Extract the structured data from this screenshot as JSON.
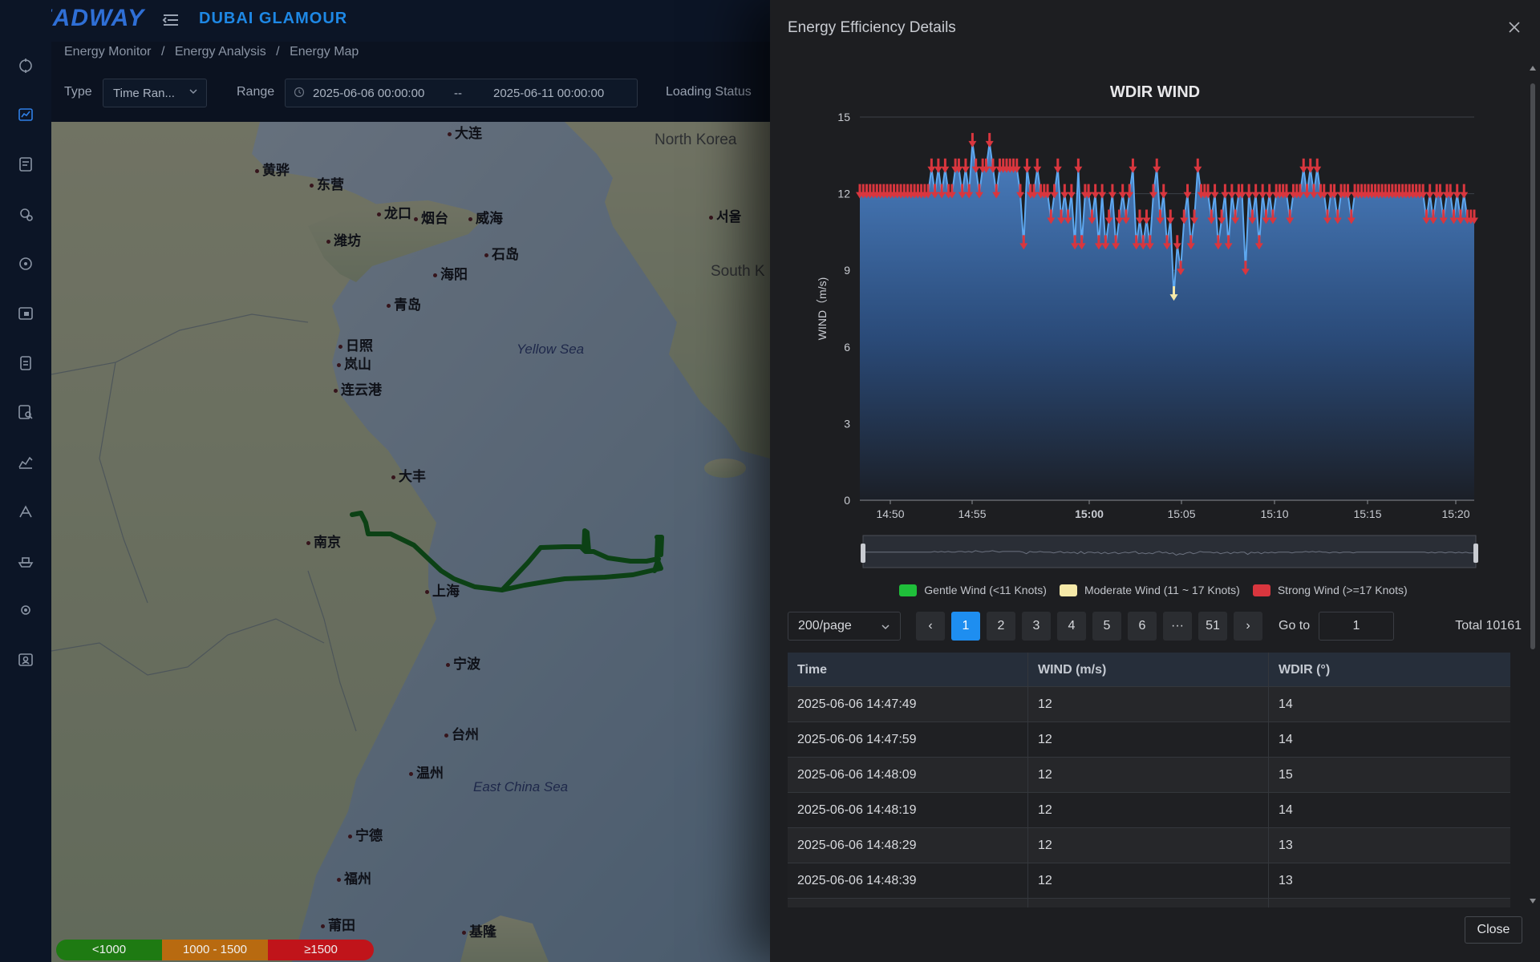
{
  "app": {
    "logo_main": "HEADWAY",
    "vessel_name": "DUBAI GLAMOUR",
    "icons": [
      "menu-toggle-icon"
    ]
  },
  "breadcrumb": [
    "Energy Monitor",
    "/",
    "Energy Analysis",
    "/",
    "Energy Map"
  ],
  "filters": {
    "type_label": "Type",
    "type_value": "Time Ran...",
    "range_label": "Range",
    "range_start": "2025-06-06 00:00:00",
    "range_sep": "--",
    "range_end": "2025-06-11 00:00:00",
    "loading_label": "Loading Status"
  },
  "sidebar": {
    "icons": [
      "compass-icon",
      "chart-icon",
      "report-icon",
      "settings-gear-icon",
      "target-icon",
      "calendar-icon",
      "clipboard-icon",
      "search-doc-icon",
      "trend-icon",
      "tools-icon",
      "ship-icon",
      "gear-icon",
      "user-card-icon"
    ]
  },
  "map": {
    "places": [
      {
        "name": "大连"
      },
      {
        "name": "黄骅"
      },
      {
        "name": "东营"
      },
      {
        "name": "龙口"
      },
      {
        "name": "烟台"
      },
      {
        "name": "威海"
      },
      {
        "name": "潍坊"
      },
      {
        "name": "石岛"
      },
      {
        "name": "海阳"
      },
      {
        "name": "青岛"
      },
      {
        "name": "日照"
      },
      {
        "name": "岚山"
      },
      {
        "name": "连云港"
      },
      {
        "name": "大丰"
      },
      {
        "name": "南京"
      },
      {
        "name": "上海"
      },
      {
        "name": "宁波"
      },
      {
        "name": "台州"
      },
      {
        "name": "温州"
      },
      {
        "name": "宁德"
      },
      {
        "name": "福州"
      },
      {
        "name": "莆田"
      },
      {
        "name": "基隆"
      },
      {
        "name": "서울"
      }
    ],
    "seas": [
      "Yellow Sea",
      "East China Sea"
    ],
    "countries": [
      "North Korea",
      "South K"
    ],
    "legend": [
      {
        "label": "<1000",
        "color": "#1e7a12"
      },
      {
        "label": "1000 - 1500",
        "color": "#b86a10"
      },
      {
        "label": "≥1500",
        "color": "#c0141a"
      }
    ],
    "route_color": "#0d6b0d"
  },
  "drawer": {
    "title": "Energy Efficiency Details",
    "close_button": "Close"
  },
  "chart_data": {
    "type": "line",
    "title": "WDIR WIND",
    "ylabel": "WIND（m/s)",
    "xlabel": "",
    "ylim": [
      0,
      15
    ],
    "yticks": [
      "0",
      "3",
      "6",
      "9",
      "12",
      "15"
    ],
    "xticks": [
      "14:50",
      "14:55",
      "15:00",
      "15:05",
      "15:10",
      "15:15",
      "15:20"
    ],
    "x_range": [
      "14:47:49",
      "15:20:30"
    ],
    "grid": true,
    "legend_position": "bottom",
    "legend": [
      {
        "name": "Gentle Wind (<11 Knots)",
        "color": "#1fbf3a"
      },
      {
        "name": "Moderate Wind (11 ~ 17 Knots)",
        "color": "#f5e9a8"
      },
      {
        "name": "Strong Wind (>=17 Knots)",
        "color": "#d9363e"
      }
    ],
    "series": [
      {
        "name": "WIND",
        "line_color": "#5ea8f0",
        "values": [
          12,
          12,
          12,
          12,
          12,
          12,
          12,
          12,
          12,
          12,
          12,
          12,
          12,
          12,
          12,
          12,
          12,
          12,
          12,
          12,
          12,
          13,
          12,
          13,
          12,
          13,
          12,
          12,
          13,
          13,
          12,
          13,
          12,
          14,
          13,
          12,
          13,
          13,
          14,
          13,
          12,
          13,
          13,
          13,
          13,
          13,
          13,
          12,
          10,
          13,
          12,
          12,
          13,
          12,
          12,
          12,
          11,
          12,
          13,
          11,
          12,
          11,
          12,
          10,
          13,
          10,
          12,
          12,
          11,
          12,
          10,
          12,
          10,
          11,
          12,
          10,
          11,
          12,
          11,
          12,
          13,
          10,
          11,
          10,
          11,
          10,
          12,
          13,
          11,
          12,
          10,
          11,
          8,
          10,
          9,
          11,
          12,
          10,
          11,
          13,
          12,
          12,
          12,
          11,
          12,
          10,
          11,
          12,
          10,
          12,
          11,
          12,
          12,
          9,
          12,
          11,
          12,
          10,
          12,
          11,
          12,
          11,
          12,
          12,
          12,
          12,
          11,
          12,
          12,
          12,
          13,
          12,
          13,
          12,
          13,
          12,
          12,
          11,
          12,
          12,
          11,
          12,
          12,
          12,
          11,
          12,
          12,
          12,
          12,
          12,
          12,
          12,
          12,
          12,
          12,
          12,
          12,
          12,
          12,
          12,
          12,
          12,
          12,
          12,
          12,
          12,
          11,
          12,
          11,
          12,
          12,
          11,
          12,
          12,
          11,
          12,
          11,
          12,
          11,
          11,
          11
        ]
      }
    ]
  },
  "pagination": {
    "page_size": "200/page",
    "pages": [
      "1",
      "2",
      "3",
      "4",
      "5",
      "6",
      "···",
      "51"
    ],
    "current_page": "1",
    "prev": "‹",
    "next": "›",
    "goto_label": "Go to",
    "goto_value": "1",
    "total": "Total 10161"
  },
  "table": {
    "headers": [
      "Time",
      "WIND (m/s)",
      "WDIR (°)"
    ],
    "rows": [
      [
        "2025-06-06 14:47:49",
        "12",
        "14"
      ],
      [
        "2025-06-06 14:47:59",
        "12",
        "14"
      ],
      [
        "2025-06-06 14:48:09",
        "12",
        "15"
      ],
      [
        "2025-06-06 14:48:19",
        "12",
        "14"
      ],
      [
        "2025-06-06 14:48:29",
        "12",
        "13"
      ],
      [
        "2025-06-06 14:48:39",
        "12",
        "13"
      ],
      [
        "",
        "",
        ""
      ]
    ]
  }
}
